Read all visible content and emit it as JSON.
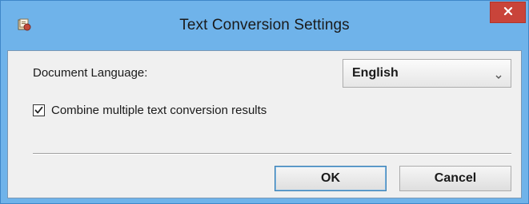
{
  "window": {
    "title": "Text Conversion Settings",
    "icon": "app-icon",
    "close_icon": "close-icon",
    "colors": {
      "titlebar": "#6fb3ea",
      "close": "#c9443a"
    }
  },
  "form": {
    "language_label": "Document Language:",
    "language_value": "English",
    "combine_label": "Combine multiple text conversion results",
    "combine_checked": true
  },
  "buttons": {
    "ok_label": "OK",
    "cancel_label": "Cancel"
  }
}
